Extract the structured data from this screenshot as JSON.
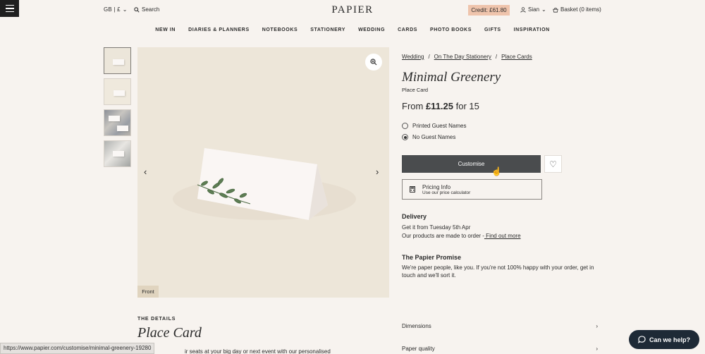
{
  "header": {
    "locale": "GB | £",
    "search_label": "Search",
    "logo": "PAPIER",
    "credit": "Credit: £61.80",
    "user": "Sian",
    "basket": "Basket (0 items)"
  },
  "nav": [
    "NEW IN",
    "DIARIES & PLANNERS",
    "NOTEBOOKS",
    "STATIONERY",
    "WEDDING",
    "CARDS",
    "PHOTO BOOKS",
    "GIFTS",
    "INSPIRATION"
  ],
  "gallery": {
    "front_label": "Front"
  },
  "breadcrumb": [
    "Wedding",
    "On The Day Stationery",
    "Place Cards"
  ],
  "product": {
    "title": "Minimal Greenery",
    "subtitle": "Place Card",
    "price_prefix": "From ",
    "price": "£11.25",
    "price_suffix": " for 15",
    "options": [
      "Printed Guest Names",
      "No Guest Names"
    ],
    "selected_option": "No Guest Names",
    "customise_label": "Customise",
    "pricing_title": "Pricing Info",
    "pricing_sub": "Use our price calculator"
  },
  "delivery": {
    "heading": "Delivery",
    "line1": "Get it from Tuesday 5th Apr",
    "line2": "Our products are made to order -",
    "link": " Find out more"
  },
  "promise": {
    "heading": "The Papier Promise",
    "text": "We're paper people, like you. If you're not 100% happy with your order, get in touch and we'll sort it."
  },
  "details": {
    "label": "THE DETAILS",
    "title": "Place Card",
    "body": "ir seats at your big day or next event with our personalised",
    "accordion": [
      "Dimensions",
      "Paper quality"
    ]
  },
  "status_url": "https://www.papier.com/customise/minimal-greenery-19280",
  "help_label": "Can we help?"
}
